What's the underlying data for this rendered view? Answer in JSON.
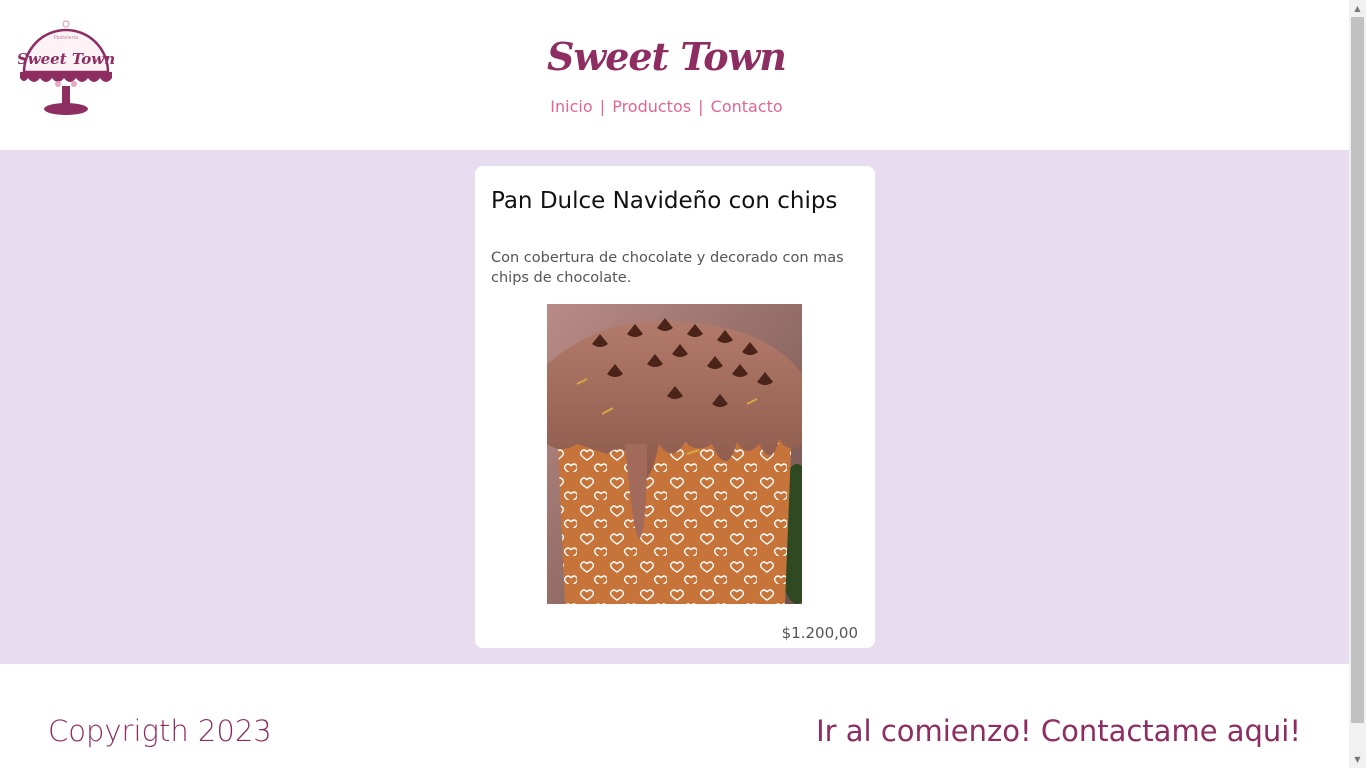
{
  "header": {
    "logo": {
      "icon": "sweet-town-cake-stand-logo",
      "small_text": "Pasteleria",
      "text": "Sweet Town"
    },
    "brand": "Sweet Town",
    "nav": [
      {
        "label": "Inicio"
      },
      {
        "label": "Productos"
      },
      {
        "label": "Contacto"
      }
    ],
    "nav_separator": "|"
  },
  "product": {
    "title": "Pan Dulce Navideño con chips",
    "description": "Con cobertura de chocolate y decorado con mas chips de chocolate.",
    "image_alt": "Pan dulce con cobertura de chocolate",
    "price": "$1.200,00"
  },
  "footer": {
    "copyright": "Copyrigth 2023",
    "link_top": "Ir al comienzo!",
    "link_contact": "Contactame aqui!"
  },
  "colors": {
    "brand": "#8e2d62",
    "nav": "#e0678f",
    "band": "#e8dcf0"
  }
}
